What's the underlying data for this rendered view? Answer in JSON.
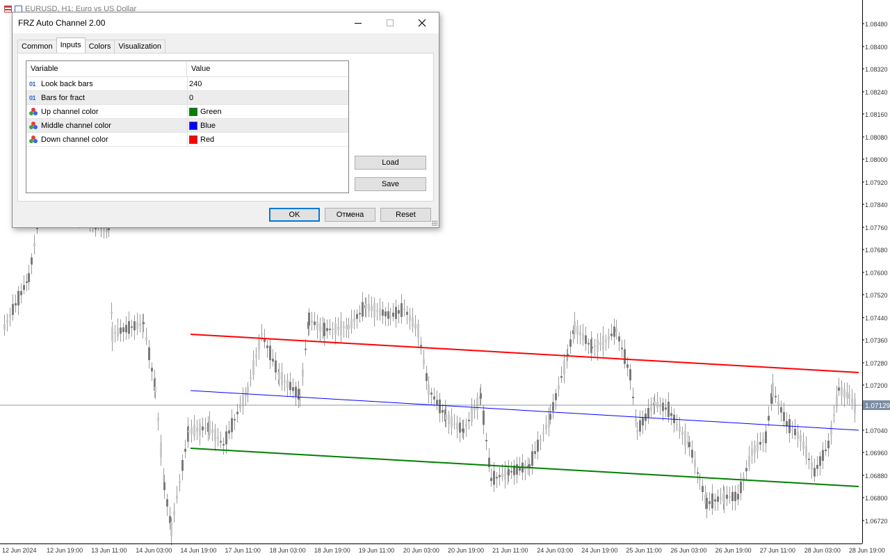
{
  "chart": {
    "symbol_title": "EURUSD, H1:  Euro vs US Dollar",
    "current_price": "1.07129",
    "price_labels": [
      "1.08480",
      "1.08400",
      "1.08320",
      "1.08240",
      "1.08160",
      "1.08080",
      "1.08000",
      "1.07920",
      "1.07840",
      "1.07760",
      "1.07680",
      "1.07600",
      "1.07520",
      "1.07440",
      "1.07360",
      "1.07280",
      "1.07200",
      "1.07040",
      "1.06960",
      "1.06880",
      "1.06800",
      "1.06720"
    ],
    "time_labels": [
      "12 Jun 2024",
      "12 Jun 19:00",
      "13 Jun 11:00",
      "14 Jun 03:00",
      "14 Jun 19:00",
      "17 Jun 11:00",
      "18 Jun 03:00",
      "18 Jun 19:00",
      "19 Jun 11:00",
      "20 Jun 03:00",
      "20 Jun 19:00",
      "21 Jun 11:00",
      "24 Jun 03:00",
      "24 Jun 19:00",
      "25 Jun 11:00",
      "26 Jun 03:00",
      "26 Jun 19:00",
      "27 Jun 11:00",
      "28 Jun 03:00",
      "28 Jun 19:00"
    ],
    "colors": {
      "up_channel": "#ff0000",
      "middle_channel": "#0000ff",
      "down_channel": "#008000",
      "candle": "#909090",
      "price_line": "#8899aa"
    }
  },
  "dialog": {
    "title": "FRZ Auto Channel 2.00",
    "tabs": [
      {
        "label": "Common",
        "active": false
      },
      {
        "label": "Inputs",
        "active": true
      },
      {
        "label": "Colors",
        "active": false
      },
      {
        "label": "Visualization",
        "active": false
      }
    ],
    "table": {
      "headers": {
        "variable": "Variable",
        "value": "Value"
      },
      "rows": [
        {
          "variable": "Look back bars",
          "value": "240",
          "type": "int-icon"
        },
        {
          "variable": "Bars for fract",
          "value": "0",
          "type": "int-icon"
        },
        {
          "variable": "Up channel color",
          "value": "Green",
          "type": "color-icon",
          "swatch": "#008000"
        },
        {
          "variable": "Middle channel color",
          "value": "Blue",
          "type": "color-icon",
          "swatch": "#0000ff"
        },
        {
          "variable": "Down channel color",
          "value": "Red",
          "type": "color-icon",
          "swatch": "#ff0000"
        }
      ]
    },
    "buttons": {
      "load": "Load",
      "save": "Save",
      "ok": "OK",
      "cancel": "Отмена",
      "reset": "Reset"
    }
  }
}
